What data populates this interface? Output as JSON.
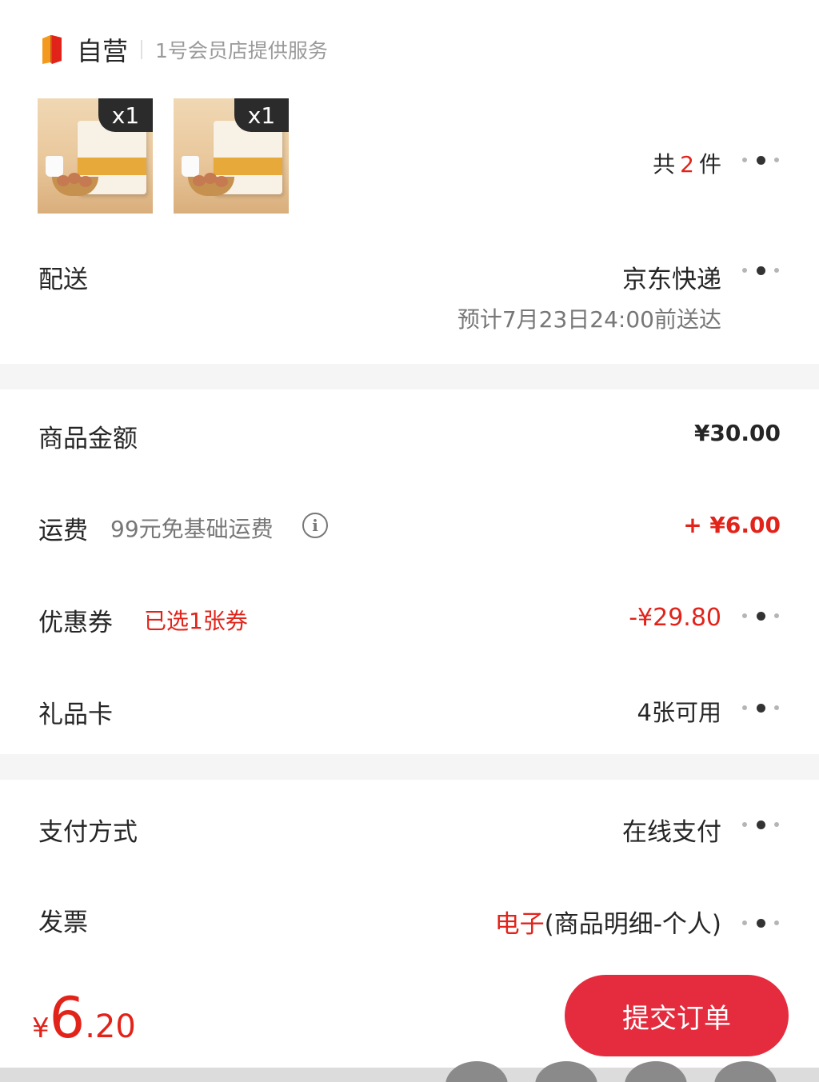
{
  "store": {
    "name": "自营",
    "service": "1号会员店提供服务"
  },
  "products": {
    "items": [
      {
        "quantity": "x1"
      },
      {
        "quantity": "x1"
      }
    ],
    "count_prefix": "共",
    "count": "2",
    "count_suffix": "件"
  },
  "delivery": {
    "label": "配送",
    "carrier": "京东快递",
    "estimate": "预计7月23日24:00前送达"
  },
  "amounts": {
    "goods_label": "商品金额",
    "goods_value": "¥30.00",
    "shipping_label": "运费",
    "shipping_note": "99元免基础运费",
    "shipping_value": "+ ¥6.00",
    "coupon_label": "优惠券",
    "coupon_note": "已选1张券",
    "coupon_value": "-¥29.80",
    "giftcard_label": "礼品卡",
    "giftcard_value": "4张可用"
  },
  "payment": {
    "method_label": "支付方式",
    "method_value": "在线支付",
    "invoice_label": "发票",
    "invoice_type": "电子",
    "invoice_detail": "(商品明细-个人)"
  },
  "footer": {
    "currency": "¥",
    "total_integer": "6",
    "total_decimal": ".20",
    "submit_label": "提交订单"
  },
  "colors": {
    "accent": "#e2231a",
    "button": "#e52c3e",
    "text": "#262626",
    "muted": "#777777"
  },
  "icons": {
    "store_logo": "jd-self-operated-logo",
    "more": "more-dots-icon",
    "info": "info-icon"
  }
}
